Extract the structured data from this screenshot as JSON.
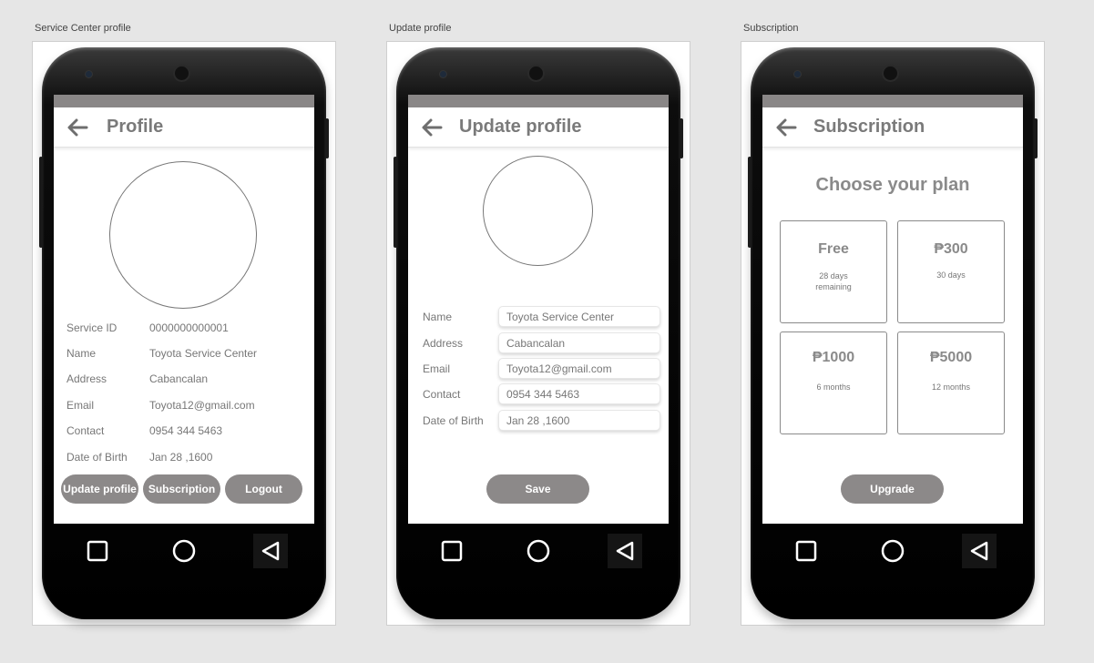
{
  "artboards": [
    {
      "label": "Service Center profile"
    },
    {
      "label": "Update profile"
    },
    {
      "label": "Subscription"
    }
  ],
  "profile": {
    "title": "Profile",
    "fields": [
      {
        "label": "Service ID",
        "value": "0000000000001"
      },
      {
        "label": "Name",
        "value": "Toyota Service Center"
      },
      {
        "label": "Address",
        "value": "Cabancalan"
      },
      {
        "label": "Email",
        "value": "Toyota12@gmail.com"
      },
      {
        "label": "Contact",
        "value": "0954 344 5463"
      },
      {
        "label": "Date of Birth",
        "value": "Jan 28 ,1600"
      }
    ],
    "buttons": {
      "update": "Update profile",
      "subscription": "Subscription",
      "logout": "Logout"
    }
  },
  "update": {
    "title": "Update profile",
    "fields": [
      {
        "label": "Name",
        "value": "Toyota Service Center"
      },
      {
        "label": "Address",
        "value": "Cabancalan"
      },
      {
        "label": "Email",
        "value": "Toyota12@gmail.com"
      },
      {
        "label": "Contact",
        "value": "0954 344 5463"
      },
      {
        "label": "Date of Birth",
        "value": "Jan 28 ,1600"
      }
    ],
    "save_label": "Save"
  },
  "subscription": {
    "title": "Subscription",
    "heading": "Choose your plan",
    "plans": [
      {
        "price": "Free",
        "desc": "28 days remaining"
      },
      {
        "price": "₱300",
        "desc": "30 days"
      },
      {
        "price": "₱1000",
        "desc": "6 months"
      },
      {
        "price": "₱5000",
        "desc": "12 months"
      }
    ],
    "upgrade_label": "Upgrade"
  },
  "nav_icons": [
    "square-recents-icon",
    "circle-home-icon",
    "triangle-back-icon"
  ],
  "colors": {
    "button": "#8c8989",
    "status_bar": "#8a8787",
    "title": "#7a7a7a",
    "canvas": "#e6e6e6"
  }
}
